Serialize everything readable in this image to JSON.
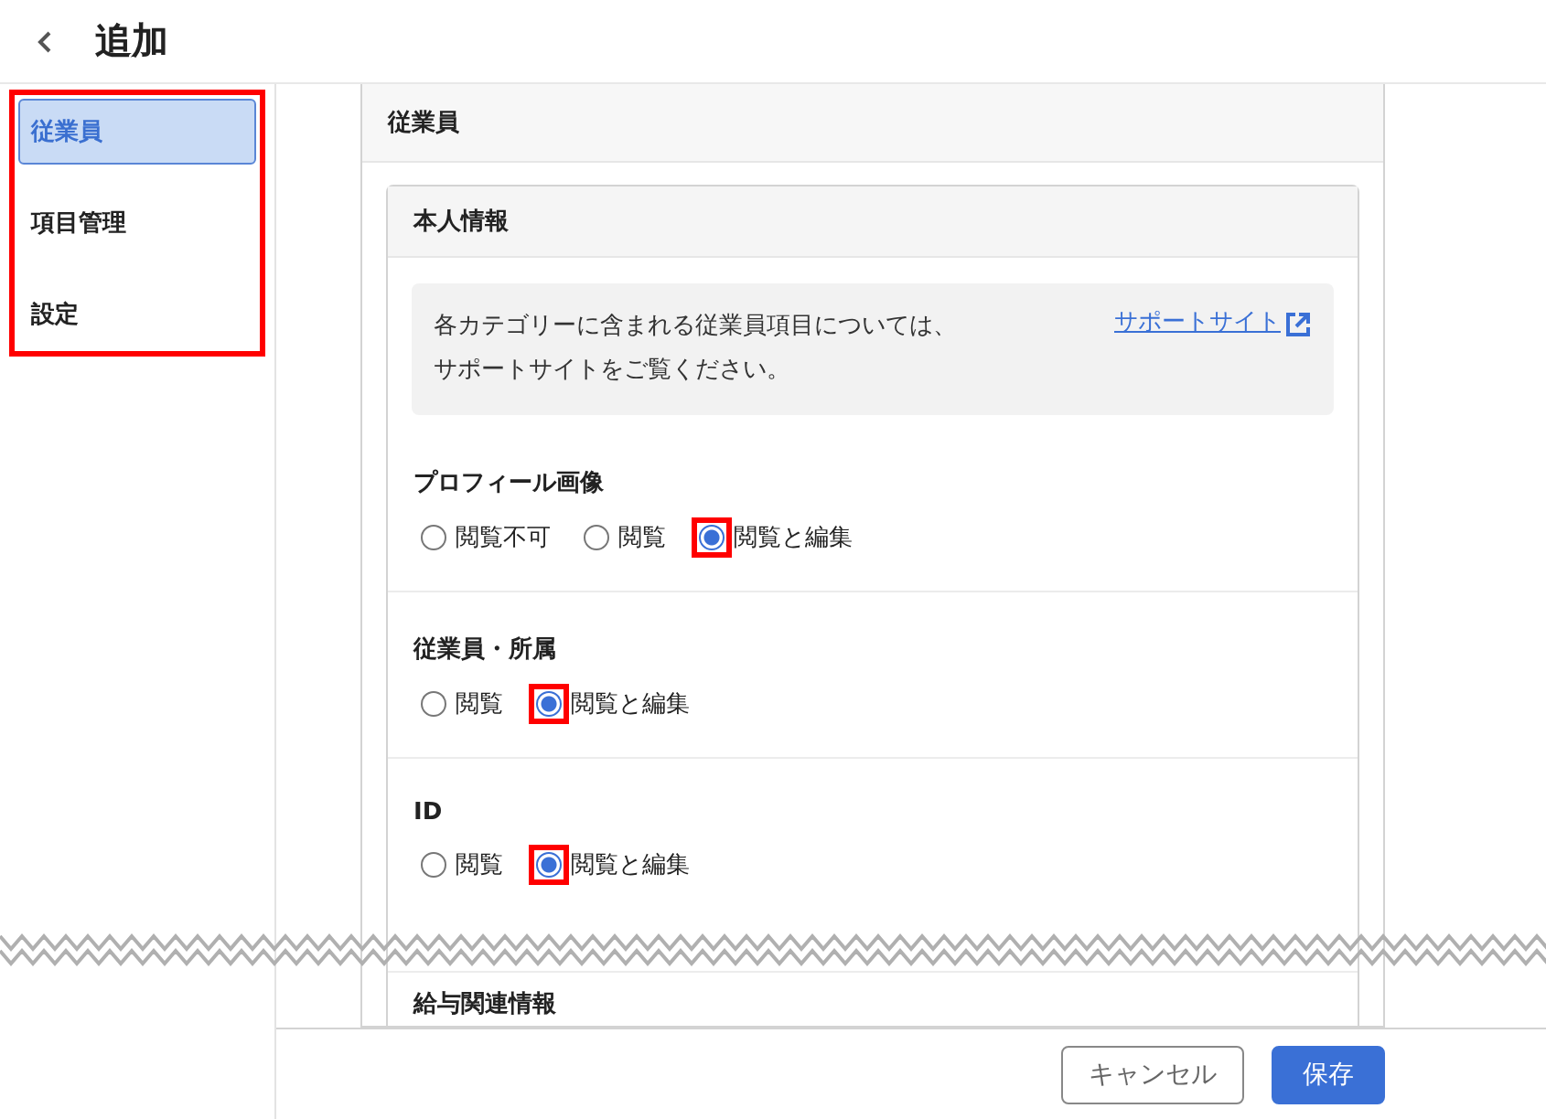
{
  "header": {
    "title": "追加"
  },
  "sidebar": {
    "highlighted": true,
    "items": [
      {
        "label": "従業員",
        "selected": true
      },
      {
        "label": "項目管理",
        "selected": false
      },
      {
        "label": "設定",
        "selected": false
      }
    ]
  },
  "panel": {
    "title": "従業員",
    "card": {
      "title": "本人情報",
      "notice": {
        "text": "各カテゴリーに含まれる従業員項目については、サポートサイトをご覧ください。",
        "link": "サポートサイト"
      },
      "sections": [
        {
          "title": "プロフィール画像",
          "options": [
            {
              "label": "閲覧不可",
              "selected": false,
              "highlighted": false
            },
            {
              "label": "閲覧",
              "selected": false,
              "highlighted": false
            },
            {
              "label": "閲覧と編集",
              "selected": true,
              "highlighted": true
            }
          ]
        },
        {
          "title": "従業員・所属",
          "options": [
            {
              "label": "閲覧",
              "selected": false,
              "highlighted": false
            },
            {
              "label": "閲覧と編集",
              "selected": true,
              "highlighted": true
            }
          ]
        },
        {
          "title": "ID",
          "options": [
            {
              "label": "閲覧",
              "selected": false,
              "highlighted": false
            },
            {
              "label": "閲覧と編集",
              "selected": true,
              "highlighted": true
            }
          ]
        },
        {
          "title": "給与関連情報"
        }
      ]
    }
  },
  "footer": {
    "buttons": [
      {
        "label": "キャンセル",
        "kind": "secondary"
      },
      {
        "label": "保存",
        "kind": "primary"
      }
    ]
  }
}
